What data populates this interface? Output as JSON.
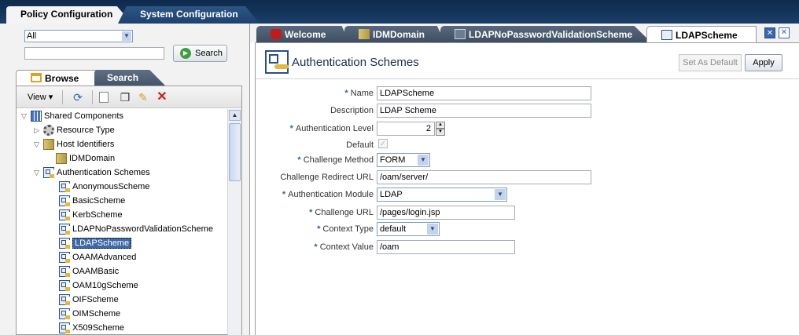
{
  "top_tabs": [
    "Policy Configuration",
    "System Configuration"
  ],
  "left": {
    "scope_select": "All",
    "search_input_value": "",
    "search_button": "Search",
    "nav_tabs": [
      "Browse",
      "Search"
    ],
    "toolbar": {
      "view_menu": "View ▾"
    },
    "tree": [
      "Shared Components",
      "Resource Type",
      "Host Identifiers",
      "IDMDomain",
      "Authentication Schemes",
      "AnonymousScheme",
      "BasicScheme",
      "KerbScheme",
      "LDAPNoPasswordValidationScheme",
      "LDAPScheme",
      "OAAMAdvanced",
      "OAAMBasic",
      "OAM10gScheme",
      "OIFScheme",
      "OIMScheme",
      "X509Scheme"
    ]
  },
  "doc_tabs": [
    "Welcome",
    "IDMDomain",
    "LDAPNoPasswordValidationScheme",
    "LDAPScheme"
  ],
  "page": {
    "title": "Authentication Schemes",
    "set_default_button": "Set As Default",
    "apply_button": "Apply"
  },
  "form": {
    "name_label": "Name",
    "name_value": "LDAPScheme",
    "description_label": "Description",
    "description_value": "LDAP Scheme",
    "auth_level_label": "Authentication Level",
    "auth_level_value": "2",
    "default_label": "Default",
    "default_checked": true,
    "challenge_method_label": "Challenge Method",
    "challenge_method_value": "FORM",
    "redirect_url_label": "Challenge Redirect URL",
    "redirect_url_value": "/oam/server/",
    "auth_module_label": "Authentication Module",
    "auth_module_value": "LDAP",
    "challenge_url_label": "Challenge URL",
    "challenge_url_value": "/pages/login.jsp",
    "context_type_label": "Context Type",
    "context_type_value": "default",
    "context_value_label": "Context Value",
    "context_value_value": "/oam"
  },
  "required_marker": "*"
}
